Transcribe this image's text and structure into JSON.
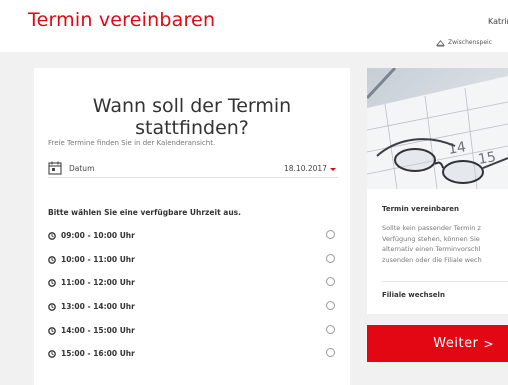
{
  "header": {
    "title": "Termin vereinbaren",
    "user_name": "Katrin",
    "save_label": "Zwischenspeic"
  },
  "main": {
    "heading": "Wann soll der Termin stattfinden?",
    "hint": "Freie Termine finden Sie in der Kalenderansicht.",
    "date_label": "Datum",
    "date_value": "18.10.2017",
    "slot_prompt": "Bitte wählen Sie eine verfügbare Uhrzeit aus.",
    "slots": [
      {
        "time": "09:00 - 10:00 Uhr"
      },
      {
        "time": "10:00 - 11:00 Uhr"
      },
      {
        "time": "11:00 - 12:00 Uhr"
      },
      {
        "time": "13:00 - 14:00 Uhr"
      },
      {
        "time": "14:00 - 15:00 Uhr"
      },
      {
        "time": "15:00 - 16:00 Uhr"
      }
    ]
  },
  "sidebar": {
    "title": "Termin vereinbaren",
    "text_lines": [
      "Sollte kein passender Termin z",
      "Verfügung stehen, können Sie",
      "alternativ einen Terminvorschl",
      "zusenden oder die Filiale wech"
    ],
    "link_label": "Filiale wechseln",
    "image_numbers": [
      "14",
      "15"
    ]
  },
  "footer": {
    "next_label": "Weiter",
    "next_arrow": ">"
  },
  "colors": {
    "accent": "#e30613",
    "background": "#f1f1f1"
  },
  "icons": {
    "calendar": "calendar-icon",
    "clock": "clock-icon",
    "save": "save-icon",
    "caret": "caret-down-icon"
  }
}
